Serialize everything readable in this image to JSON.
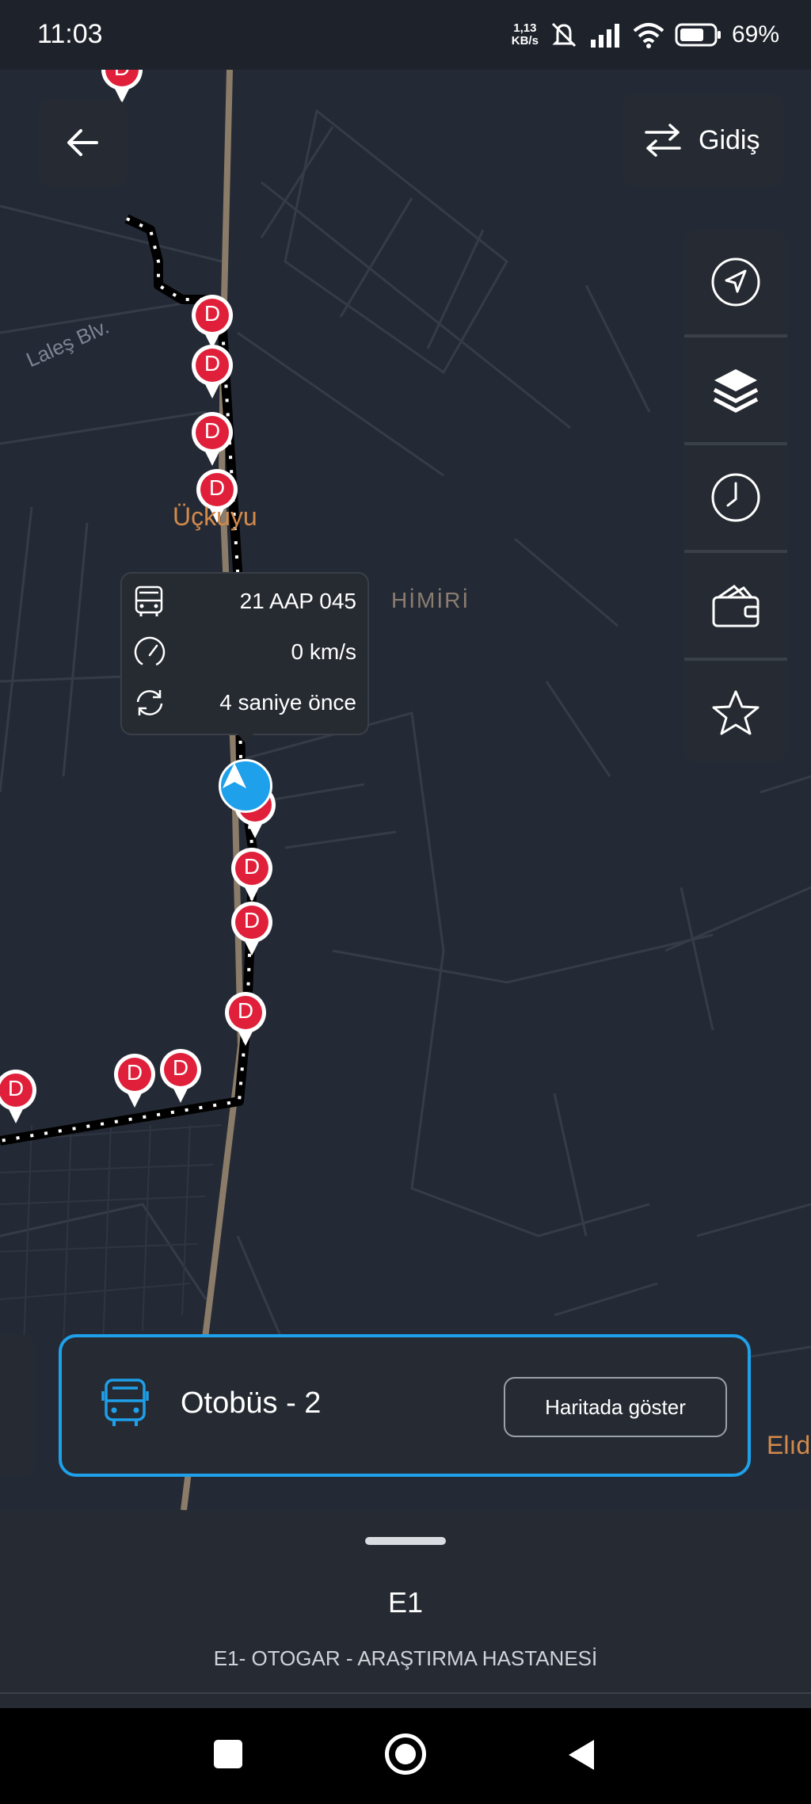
{
  "status_bar": {
    "time": "11:03",
    "net_speed_value": "1,13",
    "net_speed_unit": "KB/s",
    "battery_percent": "69%",
    "icons": [
      "mute-icon",
      "signal-icon",
      "wifi-icon",
      "battery-icon"
    ]
  },
  "map": {
    "labels": {
      "street": "Laleş Blv.",
      "district_1": "Üçkuyu",
      "district_2": "HİMİRİ",
      "district_3": "Elıd"
    },
    "stop_marker_letter": "D"
  },
  "direction_button": {
    "label": "Gidiş"
  },
  "side_controls": [
    "location-arrow-icon",
    "layers-icon",
    "clock-icon",
    "wallet-icon",
    "star-icon"
  ],
  "vehicle_popup": {
    "plate": "21 AAP 045",
    "speed": "0 km/s",
    "updated": "4 saniye önce"
  },
  "bus_card": {
    "title": "Otobüs - 2",
    "show_on_map": "Haritada göster"
  },
  "route_sheet": {
    "code": "E1",
    "name": "E1- OTOGAR - ARAŞTIRMA HASTANESİ"
  },
  "colors": {
    "accent": "#1fa0ea",
    "stop_marker": "#e0203a",
    "district_label": "#d48a4b",
    "map_bg": "#242a35"
  }
}
